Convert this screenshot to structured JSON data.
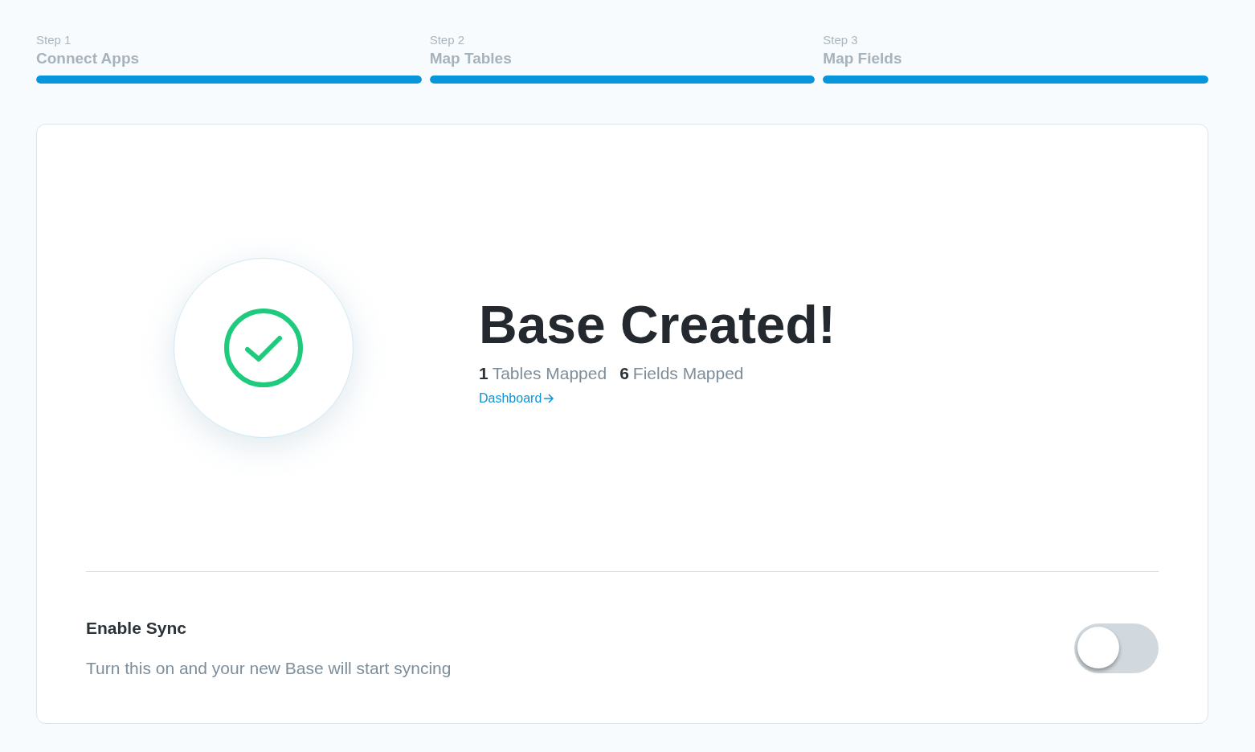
{
  "steps": [
    {
      "step": "Step 1",
      "label": "Connect Apps",
      "level": 1
    },
    {
      "step": "Step 2",
      "label": "Map Tables",
      "level": 1
    },
    {
      "step": "Step 3",
      "label": "Map Fields",
      "level": 1
    }
  ],
  "result": {
    "title": "Base Created!",
    "stats": [
      {
        "count": "1",
        "label": "Tables Mapped"
      },
      {
        "count": "6",
        "label": "Fields Mapped"
      }
    ],
    "link": "Dashboard"
  },
  "sync": {
    "title": "Enable Sync",
    "description": "Turn this on and your new Base will start syncing",
    "on": false
  }
}
